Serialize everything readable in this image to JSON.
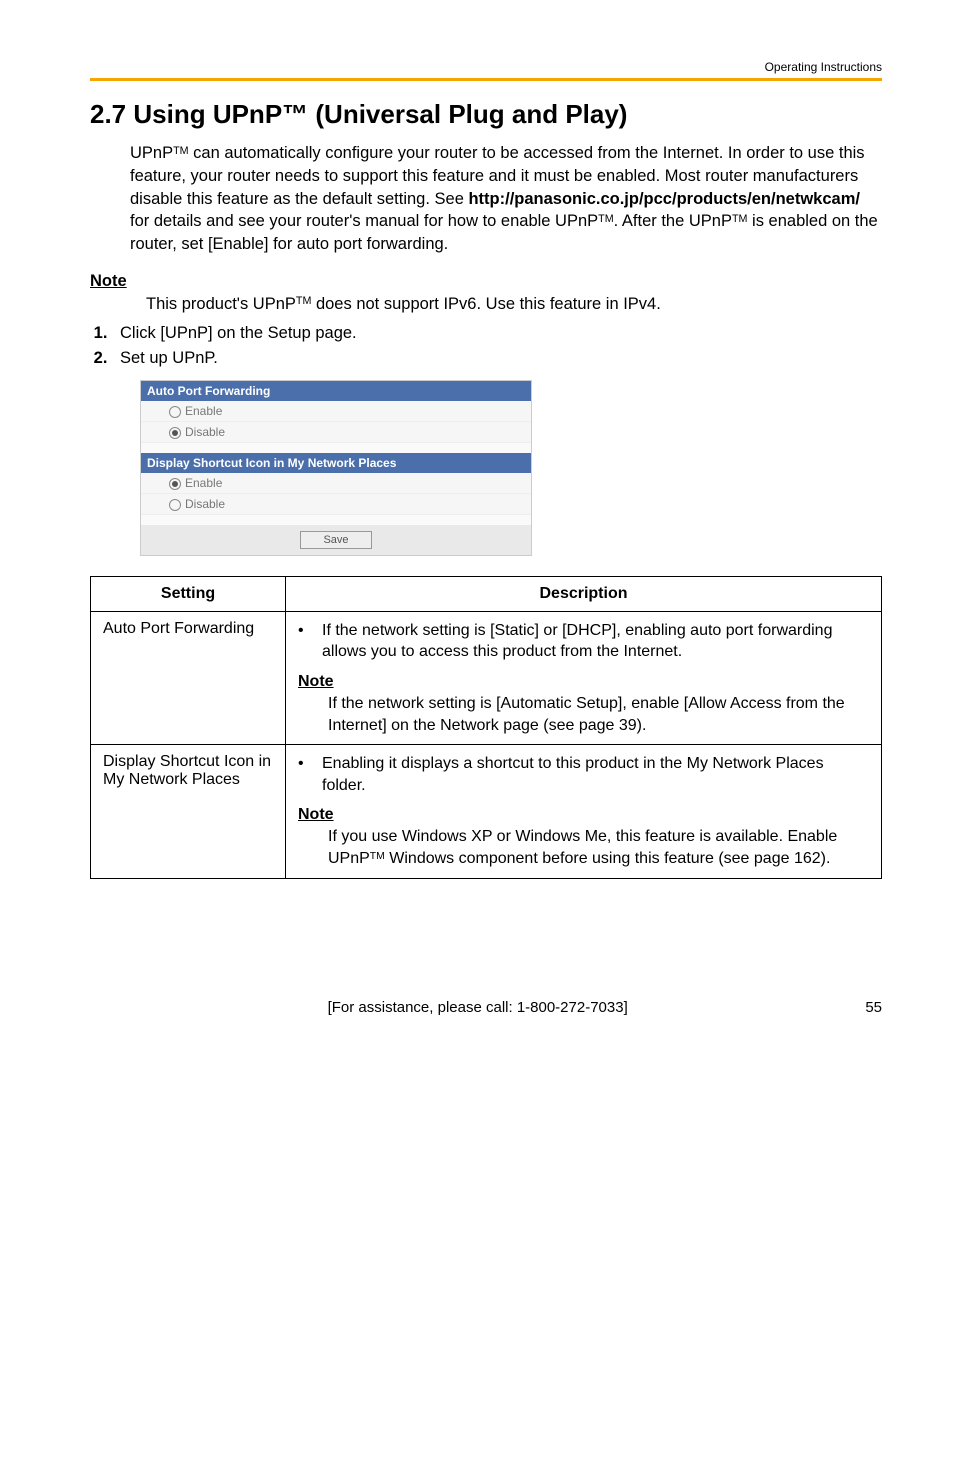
{
  "header": {
    "right_text": "Operating Instructions"
  },
  "title": "2.7   Using UPnP™ (Universal Plug and Play)",
  "intro": {
    "p1a": "UPnP",
    "p1b": " can automatically configure your router to be accessed from the Internet. In order to use this feature, your router needs to support this feature and it must be enabled. Most router manufacturers disable this feature as the default setting. See ",
    "link": "http://panasonic.co.jp/pcc/products/en/netwkcam/",
    "p1c": " for details and see your router's manual for how to enable UPnP",
    "p1d": ". After the UPnP",
    "p1e": " is enabled on the router, set [Enable] for auto port forwarding."
  },
  "note_section": {
    "heading": "Note",
    "body_a": "This product's UPnP",
    "body_b": " does not support IPv6. Use this feature in IPv4."
  },
  "steps": {
    "s1": "Click [UPnP] on the Setup page.",
    "s2": "Set up UPnP."
  },
  "screenshot": {
    "panel1_title": "Auto Port Forwarding",
    "panel1_opt1": "Enable",
    "panel1_opt2": "Disable",
    "panel2_title": "Display Shortcut Icon in My Network Places",
    "panel2_opt1": "Enable",
    "panel2_opt2": "Disable",
    "save": "Save"
  },
  "table": {
    "head_setting": "Setting",
    "head_desc": "Description",
    "row1_setting": "Auto Port Forwarding",
    "row1_bullet": "If the network setting is [Static] or [DHCP], enabling auto port forwarding allows you to access this product from the Internet.",
    "row1_note_heading": "Note",
    "row1_note_body": "If the network setting is [Automatic Setup], enable [Allow Access from the Internet] on the Network page (see page 39).",
    "row2_setting": "Display Shortcut Icon in My Network Places",
    "row2_bullet": "Enabling it displays a shortcut to this product in the My Network Places folder.",
    "row2_note_heading": "Note",
    "row2_note_body_a": "If you use Windows XP or Windows Me, this feature is available. Enable UPnP",
    "row2_note_body_b": " Windows component before using this feature (see page 162)."
  },
  "footer": {
    "assist": "[For assistance, please call: 1-800-272-7033]",
    "page": "55"
  },
  "tm": "TM"
}
